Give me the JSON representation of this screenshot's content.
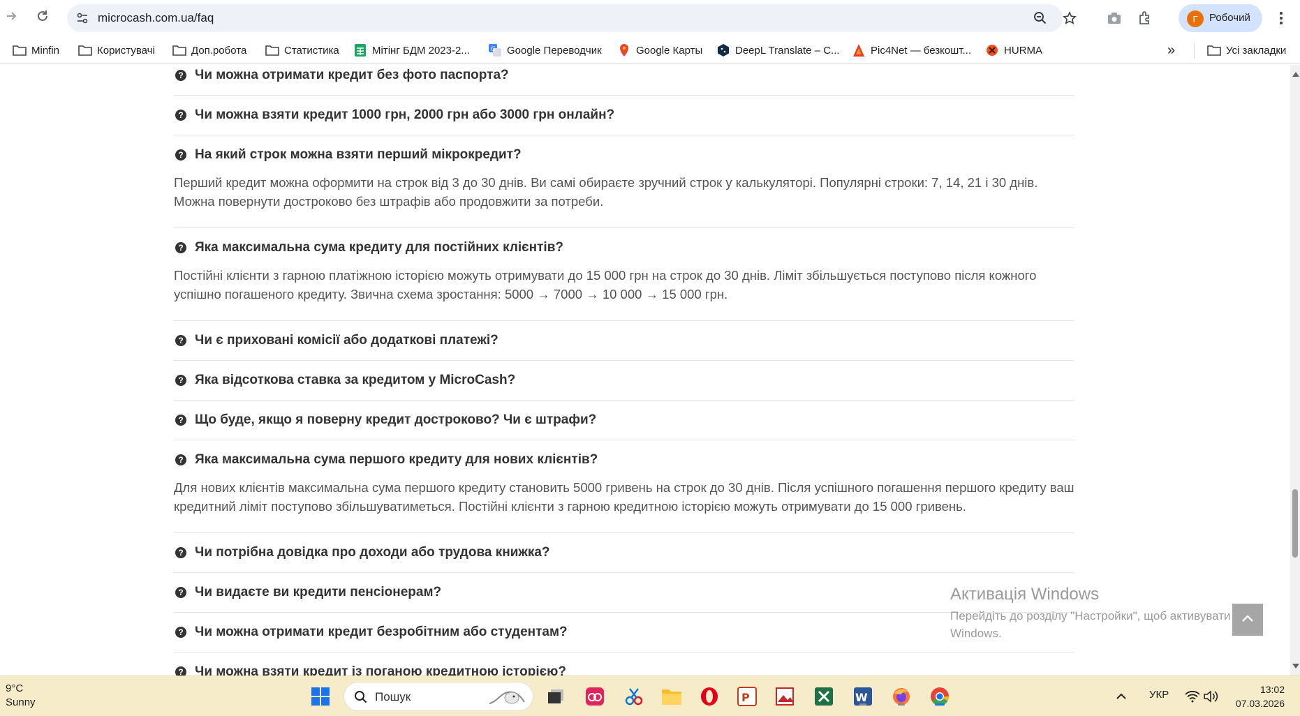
{
  "browser": {
    "url": "microcash.com.ua/faq",
    "profile_initial": "Г",
    "profile_name": "Робочий",
    "bookmarks": [
      {
        "label": "Minfin",
        "icon": "folder-icon"
      },
      {
        "label": "Користувачі",
        "icon": "folder-icon"
      },
      {
        "label": "Доп.робота",
        "icon": "folder-icon"
      },
      {
        "label": "Статистика",
        "icon": "folder-icon"
      },
      {
        "label": "Мітінг БДМ 2023-2...",
        "icon": "sheets-icon"
      },
      {
        "label": "Google Переводчик",
        "icon": "translate-icon"
      },
      {
        "label": "Google Карты",
        "icon": "maps-icon"
      },
      {
        "label": "DeepL Translate – C...",
        "icon": "deepl-icon"
      },
      {
        "label": "Pic4Net — безкошт...",
        "icon": "pic4net-icon"
      },
      {
        "label": "HURMA",
        "icon": "hurma-icon"
      }
    ],
    "all_bookmarks_label": "Усі закладки",
    "more_glyph": "»"
  },
  "faq": {
    "items": [
      {
        "question": "Чи можна отримати кредит без фото паспорта?",
        "answer": ""
      },
      {
        "question": "Чи можна взяти кредит 1000 грн, 2000 грн або 3000 грн онлайн?",
        "answer": ""
      },
      {
        "question": "На який строк можна взяти перший мікрокредит?",
        "answer": "Перший кредит можна оформити на строк від 3 до 30 днів. Ви самі обираєте зручний строк у калькуляторі. Популярні строки: 7, 14, 21 і 30 днів. Можна повернути достроково без штрафів або продовжити за потреби."
      },
      {
        "question": "Яка максимальна сума кредиту для постійних клієнтів?",
        "answer": "Постійні клієнти з гарною платіжною історією можуть отримувати до 15 000 грн на строк до 30 днів. Ліміт збільшується поступово після кожного успішно погашеного кредиту. Звична схема зростання: 5000 → 7000 → 10 000 → 15 000 грн."
      },
      {
        "question": "Чи є приховані комісії або додаткові платежі?",
        "answer": ""
      },
      {
        "question": "Яка відсоткова ставка за кредитом у MicroCash?",
        "answer": ""
      },
      {
        "question": "Що буде, якщо я поверну кредит достроково? Чи є штрафи?",
        "answer": ""
      },
      {
        "question": "Яка максимальна сума першого кредиту для нових клієнтів?",
        "answer": "Для нових клієнтів максимальна сума першого кредиту становить 5000 гривень на строк до 30 днів. Після успішного погашення першого кредиту ваш кредитний ліміт поступово збільшуватиметься. Постійні клієнти з гарною кредитною історією можуть отримувати до 15 000 гривень."
      },
      {
        "question": "Чи потрібна довідка про доходи або трудова книжка?",
        "answer": ""
      },
      {
        "question": "Чи видаєте ви кредити пенсіонерам?",
        "answer": ""
      },
      {
        "question": "Чи можна отримати кредит безробітним або студентам?",
        "answer": ""
      },
      {
        "question": "Чи можна взяти кредит із поганою кредитною історією?",
        "answer": ""
      }
    ]
  },
  "watermark": {
    "title": "Активація Windows",
    "subtitle": "Перейдіть до розділу \"Настройки\", щоб активувати Windows."
  },
  "taskbar": {
    "temperature": "9°C",
    "weather": "Sunny",
    "search_label": "Пошук",
    "language": "УКР",
    "time": "13:02",
    "date": "07.03.2026"
  },
  "colors": {
    "omnibox_bg": "#eef1f8",
    "profile_chip_bg": "#d3e3fd",
    "profile_avatar": "#e8710a",
    "taskbar_bg": "#f6ecc9",
    "question_text": "#333333",
    "answer_text": "#555555"
  }
}
